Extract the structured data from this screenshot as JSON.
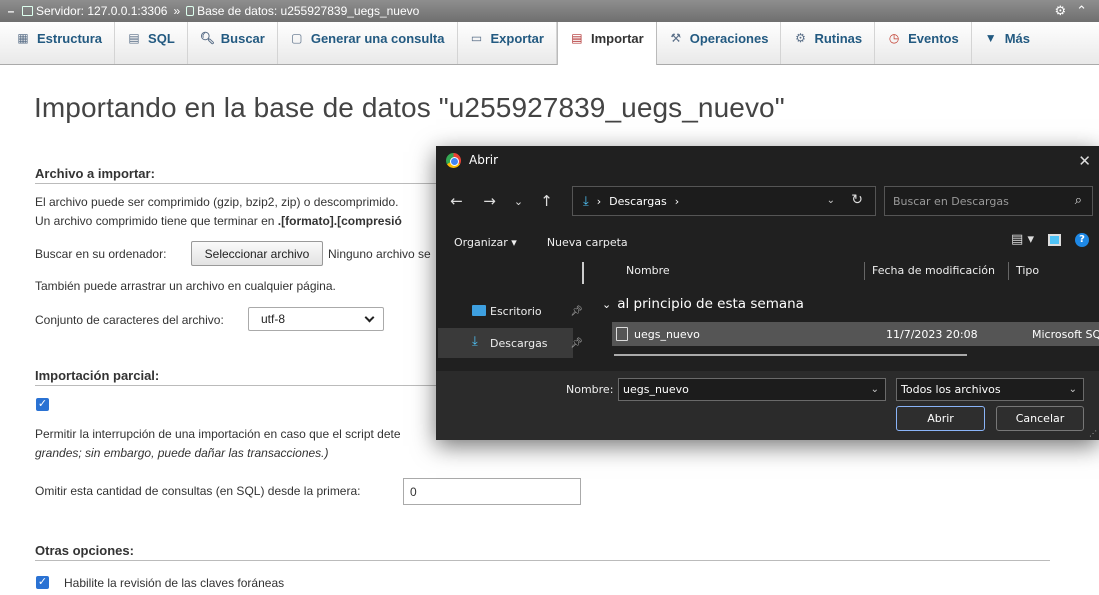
{
  "breadcrumb": {
    "server": "Servidor: 127.0.0.1:3306",
    "separator": "»",
    "database": "Base de datos: u255927839_uegs_nuevo",
    "settings_icon": "gear-icon",
    "collapse_icon": "collapse-icon"
  },
  "tabs": [
    {
      "label": "Estructura",
      "icon": "structure-icon"
    },
    {
      "label": "SQL",
      "icon": "sql-icon"
    },
    {
      "label": "Buscar",
      "icon": "search-icon"
    },
    {
      "label": "Generar una consulta",
      "icon": "query-icon"
    },
    {
      "label": "Exportar",
      "icon": "export-icon"
    },
    {
      "label": "Importar",
      "icon": "import-icon",
      "active": true
    },
    {
      "label": "Operaciones",
      "icon": "wrench-icon"
    },
    {
      "label": "Rutinas",
      "icon": "routines-icon"
    },
    {
      "label": "Eventos",
      "icon": "clock-icon"
    },
    {
      "label": "Más",
      "icon": "triangle-down-icon"
    }
  ],
  "page_title": "Importando en la base de datos \"u255927839_uegs_nuevo\"",
  "file_section": {
    "title": "Archivo a importar:",
    "line1": "El archivo puede ser comprimido (gzip, bzip2, zip) o descomprimido.",
    "line2_prefix": "Un archivo comprimido tiene que terminar en ",
    "line2_bold": ".[formato].[compresió",
    "browse_label": "Buscar en su ordenador:",
    "browse_button": "Seleccionar archivo",
    "no_file": "Ninguno archivo se",
    "drag_hint": "También puede arrastrar un archivo en cualquier página.",
    "charset_label": "Conjunto de caracteres del archivo:",
    "charset_value": "utf-8"
  },
  "partial_section": {
    "title": "Importación parcial:",
    "interrupt_checked": true,
    "interrupt_text": "Permitir la interrupción de una importación en caso que el script dete",
    "interrupt_text2": "grandes; sin embargo, puede dañar las transacciones.)",
    "skip_label": "Omitir esta cantidad de consultas (en SQL) desde la primera:",
    "skip_value": "0"
  },
  "other_section": {
    "title": "Otras opciones:",
    "fk_checked": true,
    "fk_label": "Habilite la revisión de las claves foráneas"
  },
  "dialog": {
    "title": "Abrir",
    "path_folder": "Descargas",
    "search_placeholder": "Buscar en Descargas",
    "organize": "Organizar",
    "new_folder": "Nueva carpeta",
    "sidebar": [
      {
        "label": "Escritorio"
      },
      {
        "label": "Descargas",
        "active": true
      }
    ],
    "columns": {
      "name": "Nombre",
      "date": "Fecha de modificación",
      "type": "Tipo"
    },
    "group": "al principio de esta semana",
    "files": [
      {
        "name": "uegs_nuevo",
        "date": "11/7/2023 20:08",
        "type": "Microsoft SQ"
      }
    ],
    "filename_label": "Nombre:",
    "filename_value": "uegs_nuevo",
    "filetype_value": "Todos los archivos",
    "open_button": "Abrir",
    "cancel_button": "Cancelar"
  }
}
